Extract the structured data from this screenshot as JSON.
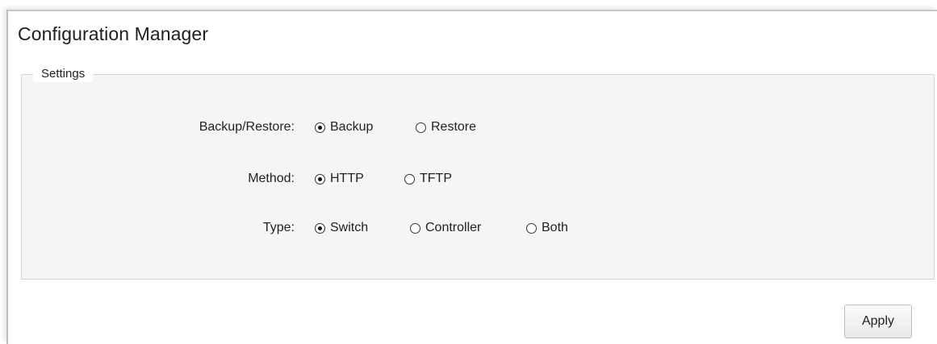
{
  "page": {
    "title": "Configuration Manager"
  },
  "settings": {
    "legend": "Settings",
    "rows": [
      {
        "label": "Backup/Restore:",
        "options": [
          {
            "label": "Backup",
            "checked": true
          },
          {
            "label": "Restore",
            "checked": false
          }
        ]
      },
      {
        "label": "Method:",
        "options": [
          {
            "label": "HTTP",
            "checked": true
          },
          {
            "label": "TFTP",
            "checked": false
          }
        ]
      },
      {
        "label": "Type:",
        "options": [
          {
            "label": "Switch",
            "checked": true
          },
          {
            "label": "Controller",
            "checked": false
          },
          {
            "label": "Both",
            "checked": false
          }
        ]
      }
    ]
  },
  "actions": {
    "apply_label": "Apply"
  }
}
